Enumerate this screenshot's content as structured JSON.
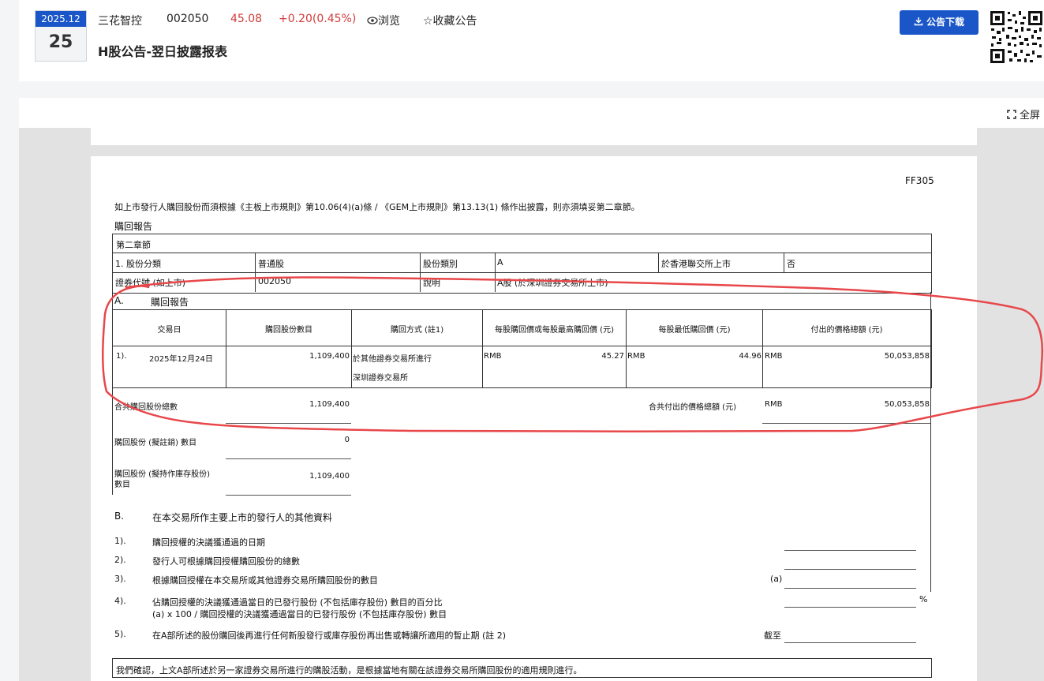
{
  "header": {
    "date_ym": "2025.12",
    "date_day": "25",
    "company": "三花智控",
    "code": "002050",
    "price": "45.08",
    "change": "+0.20(0.45%)",
    "browse": "浏览",
    "favorite": "☆收藏公告",
    "title": "H股公告-翌日披露报表",
    "download": "公告下载"
  },
  "viewer": {
    "fullscreen": "全屏"
  },
  "doc": {
    "form_code": "FF305",
    "intro": "如上市發行人購回股份而須根據《主板上市規則》第10.06(4)(a)條 / 《GEM上市規則》第13.13(1) 條作出披露，則亦須填妥第二章節。",
    "section_title": "購回報告",
    "chapter": "第二章節",
    "row1": {
      "l1": "1. 股份分類",
      "v1": "普通股",
      "l2": "股份類別",
      "v2": "A",
      "l3": "於香港聯交所上市",
      "v3": "否"
    },
    "row2": {
      "l1": "證券代號 (如上市)",
      "v1": "002050",
      "l2": "說明",
      "v2": "A股 (於深圳證券交易所上市)"
    },
    "partA": {
      "letter": "A.",
      "title": "購回報告",
      "headers": [
        "交易日",
        "購回股份數目",
        "購回方式 (註1)",
        "每股購回價或每股最高購回價 (元)",
        "每股最低購回價 (元)",
        "付出的價格總額 (元)"
      ],
      "row": {
        "idx": "1).",
        "date": "2025年12月24日",
        "shares": "1,109,400",
        "method1": "於其他證券交易所進行",
        "method2": "深圳證券交易所",
        "cur_high": "RMB",
        "high": "45.27",
        "cur_low": "RMB",
        "low": "44.96",
        "cur_total": "RMB",
        "total": "50,053,858"
      },
      "total_shares_label": "合共購回股份總數",
      "total_shares": "1,109,400",
      "total_paid_label": "合共付出的價格總額 (元)",
      "total_paid_cur": "RMB",
      "total_paid": "50,053,858",
      "cancel_label": "購回股份 (擬註銷) 數目",
      "cancel_value": "0",
      "treasury_label1": "購回股份 (擬持作庫存股份)",
      "treasury_label2": "數目",
      "treasury_value": "1,109,400"
    },
    "partB": {
      "letter": "B.",
      "title": "在本交易所作主要上市的發行人的其他資料",
      "items": [
        {
          "idx": "1).",
          "text": "購回授權的決議獲通過的日期"
        },
        {
          "idx": "2).",
          "text": "發行人可根據購回授權購回股份的總數"
        },
        {
          "idx": "3).",
          "text": "根據購回授權在本交易所或其他證券交易所購回股份的數目",
          "suffix": "(a)"
        },
        {
          "idx": "4).",
          "text": "佔購回授權的決議獲通過當日的已發行股份 (不包括庫存股份) 數目的百分比",
          "text2": "(a) x 100 / 購回授權的決議獲通過當日的已發行股份 (不包括庫存股份) 數目",
          "suffix": "%"
        },
        {
          "idx": "5).",
          "text": "在A部所述的股份購回後再進行任何新股發行或庫存股份再出售或轉讓所適用的暫止期 (註 2)",
          "suffix": "截至"
        }
      ]
    },
    "confirm": "我們確認，上文A部所述於另一家證券交易所進行的購股活動，是根據當地有關在該證券交易所購回股份的適用規則進行。"
  },
  "colors": {
    "accent": "#1a56c7",
    "up": "#d23b3b",
    "annotation": "#e8474a"
  }
}
